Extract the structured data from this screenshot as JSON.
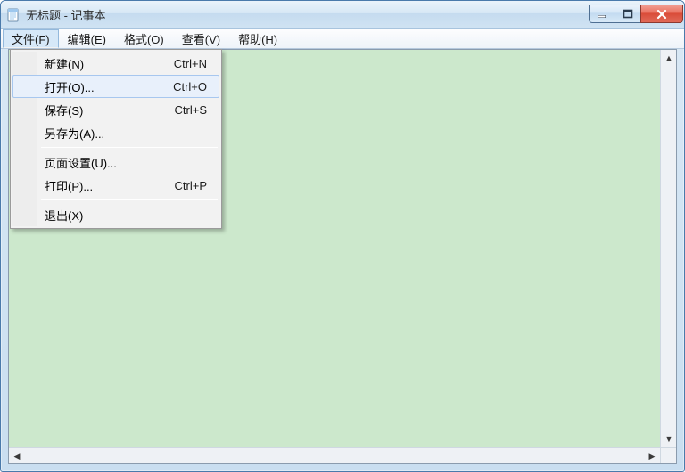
{
  "window": {
    "title": "无标题 - 记事本"
  },
  "menubar": {
    "file": "文件(F)",
    "edit": "编辑(E)",
    "format": "格式(O)",
    "view": "查看(V)",
    "help": "帮助(H)"
  },
  "filemenu": {
    "new": {
      "label": "新建(N)",
      "shortcut": "Ctrl+N"
    },
    "open": {
      "label": "打开(O)...",
      "shortcut": "Ctrl+O"
    },
    "save": {
      "label": "保存(S)",
      "shortcut": "Ctrl+S"
    },
    "saveas": {
      "label": "另存为(A)...",
      "shortcut": ""
    },
    "pagesetup": {
      "label": "页面设置(U)...",
      "shortcut": ""
    },
    "print": {
      "label": "打印(P)...",
      "shortcut": "Ctrl+P"
    },
    "exit": {
      "label": "退出(X)",
      "shortcut": ""
    }
  }
}
